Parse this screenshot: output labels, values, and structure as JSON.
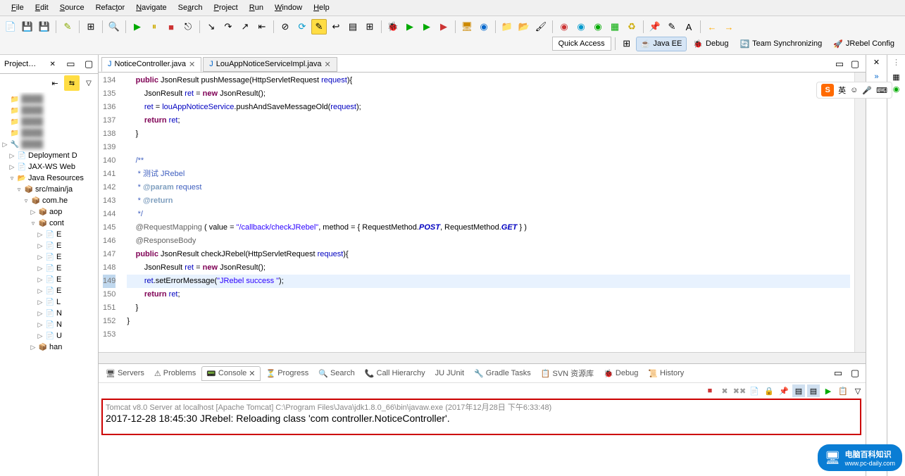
{
  "menu": [
    "File",
    "Edit",
    "Source",
    "Refactor",
    "Navigate",
    "Search",
    "Project",
    "Run",
    "Window",
    "Help"
  ],
  "quick_access": "Quick Access",
  "perspectives": {
    "java_ee": "Java EE",
    "debug": "Debug",
    "team_sync": "Team Synchronizing",
    "jrebel": "JRebel Config"
  },
  "project_explorer": {
    "title": "Project ...",
    "items": [
      {
        "icon": "📁",
        "label": "",
        "blur": true,
        "indent": 0,
        "exp": ""
      },
      {
        "icon": "📁",
        "label": "",
        "blur": true,
        "indent": 0,
        "exp": ""
      },
      {
        "icon": "📁",
        "label": "",
        "blur": true,
        "indent": 0,
        "exp": ""
      },
      {
        "icon": "📁",
        "label": "",
        "blur": true,
        "indent": 0,
        "exp": ""
      },
      {
        "icon": "🔧",
        "label": "",
        "blur": true,
        "indent": 0,
        "exp": "▷"
      },
      {
        "icon": "📄",
        "label": "Deployment D",
        "blur": false,
        "indent": 1,
        "exp": "▷"
      },
      {
        "icon": "📄",
        "label": "JAX-WS Web",
        "blur": false,
        "indent": 1,
        "exp": "▷"
      },
      {
        "icon": "📂",
        "label": "Java Resources",
        "blur": false,
        "indent": 1,
        "exp": "▿"
      },
      {
        "icon": "📦",
        "label": "src/main/ja",
        "blur": false,
        "indent": 2,
        "exp": "▿"
      },
      {
        "icon": "📦",
        "label": "com.he",
        "blur": false,
        "indent": 3,
        "exp": "▿"
      },
      {
        "icon": "📦",
        "label": "aop",
        "blur": false,
        "indent": 4,
        "exp": "▷"
      },
      {
        "icon": "📦",
        "label": "cont",
        "blur": false,
        "indent": 4,
        "exp": "▿"
      },
      {
        "icon": "📄",
        "label": "E",
        "blur": false,
        "indent": 5,
        "exp": "▷"
      },
      {
        "icon": "📄",
        "label": "E",
        "blur": false,
        "indent": 5,
        "exp": "▷"
      },
      {
        "icon": "📄",
        "label": "E",
        "blur": false,
        "indent": 5,
        "exp": "▷"
      },
      {
        "icon": "📄",
        "label": "E",
        "blur": false,
        "indent": 5,
        "exp": "▷"
      },
      {
        "icon": "📄",
        "label": "E",
        "blur": false,
        "indent": 5,
        "exp": "▷"
      },
      {
        "icon": "📄",
        "label": "E",
        "blur": false,
        "indent": 5,
        "exp": "▷"
      },
      {
        "icon": "📄",
        "label": "L",
        "blur": false,
        "indent": 5,
        "exp": "▷"
      },
      {
        "icon": "📄",
        "label": "N",
        "blur": false,
        "indent": 5,
        "exp": "▷"
      },
      {
        "icon": "📄",
        "label": "N",
        "blur": false,
        "indent": 5,
        "exp": "▷"
      },
      {
        "icon": "📄",
        "label": "U",
        "blur": false,
        "indent": 5,
        "exp": "▷"
      },
      {
        "icon": "📦",
        "label": "han",
        "blur": false,
        "indent": 4,
        "exp": "▷"
      }
    ]
  },
  "editor": {
    "tabs": [
      {
        "label": "NoticeController.java",
        "active": true
      },
      {
        "label": "LouAppNoticeServiceImpl.java",
        "active": false
      }
    ],
    "lines": [
      {
        "n": 134,
        "html": "    <span class='kw'>public</span> JsonResult pushMessage(HttpServletRequest <span class='fld'>request</span>){"
      },
      {
        "n": 135,
        "html": "        JsonResult <span class='fld'>ret</span> = <span class='kw'>new</span> JsonResult();"
      },
      {
        "n": 136,
        "html": "        <span class='fld'>ret</span> = <span class='fld'>louAppNoticeService</span>.pushAndSaveMessageOld(<span class='fld'>request</span>);"
      },
      {
        "n": 137,
        "html": "        <span class='kw'>return</span> <span class='fld'>ret</span>;"
      },
      {
        "n": 138,
        "html": "    }"
      },
      {
        "n": 139,
        "html": ""
      },
      {
        "n": 140,
        "html": "    <span class='cmt'>/**</span>"
      },
      {
        "n": 141,
        "html": "<span class='cmt'>     * 测试 JRebel</span>"
      },
      {
        "n": 142,
        "html": "<span class='cmt'>     * <span class='cmt-tag'>@param</span> request</span>"
      },
      {
        "n": 143,
        "html": "<span class='cmt'>     * <span class='cmt-tag'>@return</span></span>"
      },
      {
        "n": 144,
        "html": "<span class='cmt'>     */</span>"
      },
      {
        "n": 145,
        "html": "    <span class='ann'>@RequestMapping</span> ( value = <span class='str'>\"/callback/checkJRebel\"</span>, method = { RequestMethod.<span class='bi'>POST</span>, RequestMethod.<span class='bi'>GET</span> } )"
      },
      {
        "n": 146,
        "html": "    <span class='ann'>@ResponseBody</span>"
      },
      {
        "n": 147,
        "html": "    <span class='kw'>public</span> JsonResult checkJRebel(HttpServletRequest <span class='fld'>request</span>){"
      },
      {
        "n": 148,
        "html": "        JsonResult <span class='fld'>ret</span> = <span class='kw'>new</span> JsonResult();"
      },
      {
        "n": 149,
        "html": "        <span class='fld'>ret</span>.setErrorMessage(<span class='str'>\"JRebel success \"</span>);",
        "hl": true
      },
      {
        "n": 150,
        "html": "        <span class='kw'>return</span> <span class='fld'>ret</span>;"
      },
      {
        "n": 151,
        "html": "    }"
      },
      {
        "n": 152,
        "html": "}"
      },
      {
        "n": 153,
        "html": ""
      }
    ]
  },
  "bottom": {
    "tabs": [
      {
        "icon": "🖥",
        "label": "Servers"
      },
      {
        "icon": "⚠",
        "label": "Problems"
      },
      {
        "icon": "📟",
        "label": "Console",
        "active": true
      },
      {
        "icon": "⏳",
        "label": "Progress"
      },
      {
        "icon": "🔍",
        "label": "Search"
      },
      {
        "icon": "📞",
        "label": "Call Hierarchy"
      },
      {
        "icon": "JU",
        "label": "JUnit"
      },
      {
        "icon": "🔧",
        "label": "Gradle Tasks"
      },
      {
        "icon": "📋",
        "label": "SVN 资源库"
      },
      {
        "icon": "🐞",
        "label": "Debug"
      },
      {
        "icon": "📜",
        "label": "History"
      }
    ],
    "console_header": "Tomcat v8.0 Server at localhost [Apache Tomcat] C:\\Program Files\\Java\\jdk1.8.0_66\\bin\\javaw.exe (2017年12月28日 下午6:33:48)",
    "console_log": "2017-12-28 18:45:30 JRebel: Reloading class 'com             controller.NoticeController'."
  },
  "ime": {
    "lang": "英"
  },
  "watermark": {
    "title": "电脑百科知识",
    "url": "www.pc-daily.com"
  }
}
